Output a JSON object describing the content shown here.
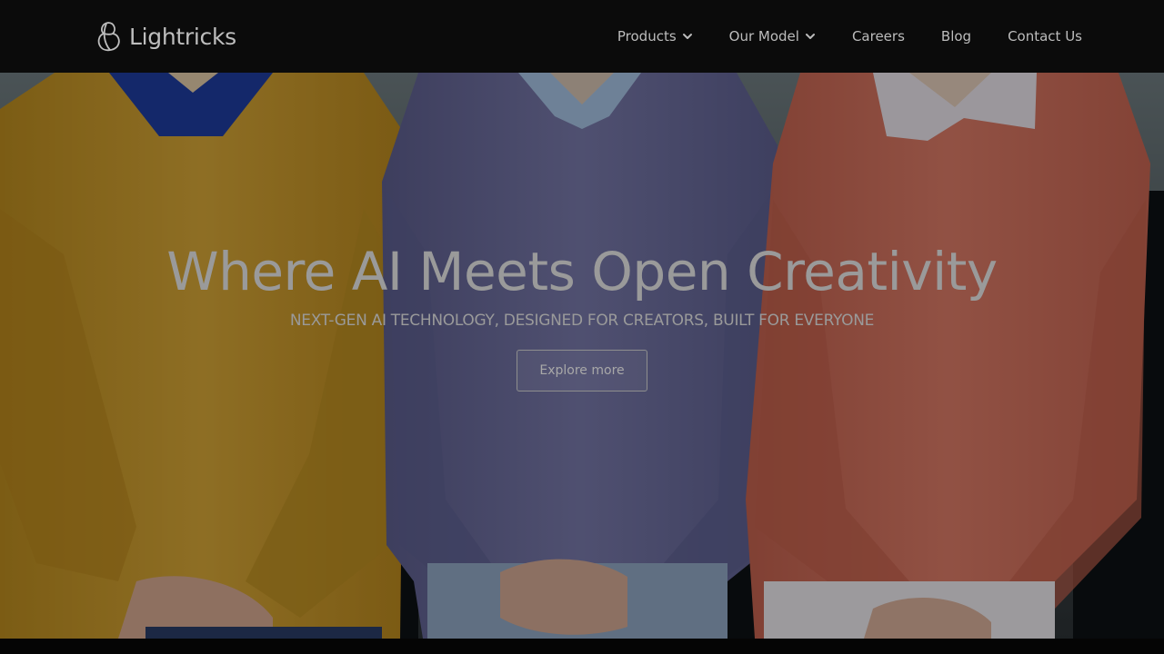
{
  "brand": {
    "name": "Lightricks",
    "logo_icon": "lightricks-logo-icon"
  },
  "nav": {
    "items": [
      {
        "label": "Products",
        "has_dropdown": true
      },
      {
        "label": "Our Model",
        "has_dropdown": true
      },
      {
        "label": "Careers",
        "has_dropdown": false
      },
      {
        "label": "Blog",
        "has_dropdown": false
      },
      {
        "label": "Contact Us",
        "has_dropdown": false
      }
    ],
    "dropdown_icon": "chevron-down-icon"
  },
  "hero": {
    "title": "Where AI Meets Open Creativity",
    "subtitle": "NEXT-GEN AI TECHNOLOGY, DESIGNED FOR CREATORS, BUILT FOR EVERYONE",
    "cta_label": "Explore more"
  },
  "colors": {
    "header_bg": "#0b0b0b",
    "nav_text": "#bcbcbc",
    "hero_text": "#9a9a9a",
    "sweater_yellow": "#c99a2a",
    "sweater_purple": "#6d6fa0",
    "sweater_coral": "#d0705c",
    "collar_blue": "#1f3fa0",
    "collar_light_blue": "#a8c4e6",
    "collar_white": "#e8e4ea"
  }
}
